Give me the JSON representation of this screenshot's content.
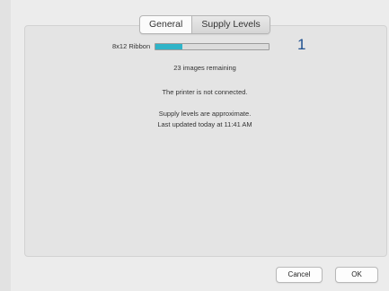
{
  "tabs": [
    {
      "label": "General",
      "selected": false
    },
    {
      "label": "Supply Levels",
      "selected": true
    }
  ],
  "supply": {
    "label": "8x12 Ribbon",
    "level_fraction": 0.24,
    "level_color": "#2fb4c8",
    "callout": "1",
    "remaining": "23 images remaining"
  },
  "status": {
    "connection": "The printer is not connected.",
    "approx_note": "Supply levels are approximate.",
    "last_updated": "Last updated today at 11:41 AM"
  },
  "buttons": {
    "cancel": "Cancel",
    "ok": "OK"
  }
}
